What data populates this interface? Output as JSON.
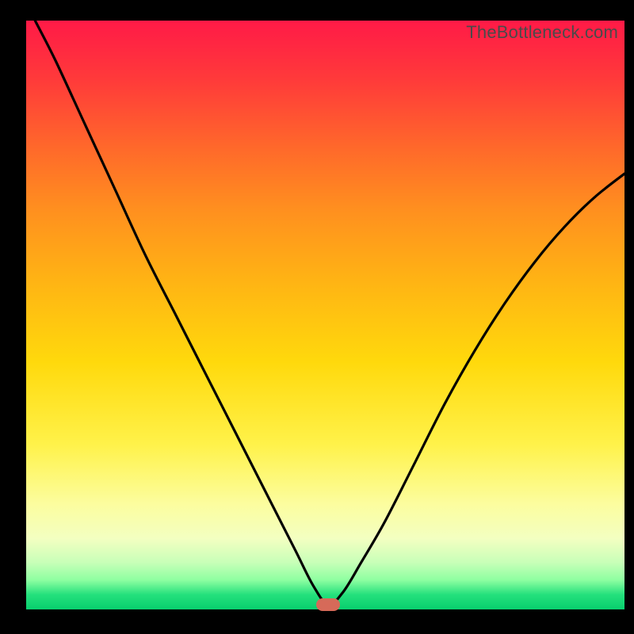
{
  "watermark": "TheBottleneck.com",
  "marker": {
    "x_frac": 0.505,
    "y_frac": 0.992
  },
  "chart_data": {
    "type": "line",
    "title": "",
    "xlabel": "",
    "ylabel": "",
    "xlim": [
      0,
      1
    ],
    "ylim": [
      0,
      1
    ],
    "series": [
      {
        "name": "curve",
        "x": [
          0.015,
          0.05,
          0.1,
          0.15,
          0.2,
          0.25,
          0.3,
          0.35,
          0.4,
          0.45,
          0.48,
          0.505,
          0.53,
          0.56,
          0.6,
          0.65,
          0.7,
          0.75,
          0.8,
          0.85,
          0.9,
          0.95,
          1.0
        ],
        "y": [
          1.0,
          0.93,
          0.82,
          0.71,
          0.6,
          0.5,
          0.4,
          0.3,
          0.2,
          0.1,
          0.04,
          0.008,
          0.03,
          0.08,
          0.15,
          0.25,
          0.35,
          0.44,
          0.52,
          0.59,
          0.65,
          0.7,
          0.74
        ]
      }
    ],
    "gradient_stops": [
      {
        "pos": 0.0,
        "color": "#ff1a47"
      },
      {
        "pos": 0.1,
        "color": "#ff3a3a"
      },
      {
        "pos": 0.22,
        "color": "#ff6a2a"
      },
      {
        "pos": 0.32,
        "color": "#ff8f1f"
      },
      {
        "pos": 0.44,
        "color": "#ffb314"
      },
      {
        "pos": 0.58,
        "color": "#ffd90c"
      },
      {
        "pos": 0.72,
        "color": "#fff24a"
      },
      {
        "pos": 0.82,
        "color": "#fcfd9e"
      },
      {
        "pos": 0.88,
        "color": "#f3ffc1"
      },
      {
        "pos": 0.92,
        "color": "#c8ffb8"
      },
      {
        "pos": 0.95,
        "color": "#8effa1"
      },
      {
        "pos": 0.975,
        "color": "#24e07c"
      },
      {
        "pos": 1.0,
        "color": "#08cf6e"
      }
    ]
  }
}
